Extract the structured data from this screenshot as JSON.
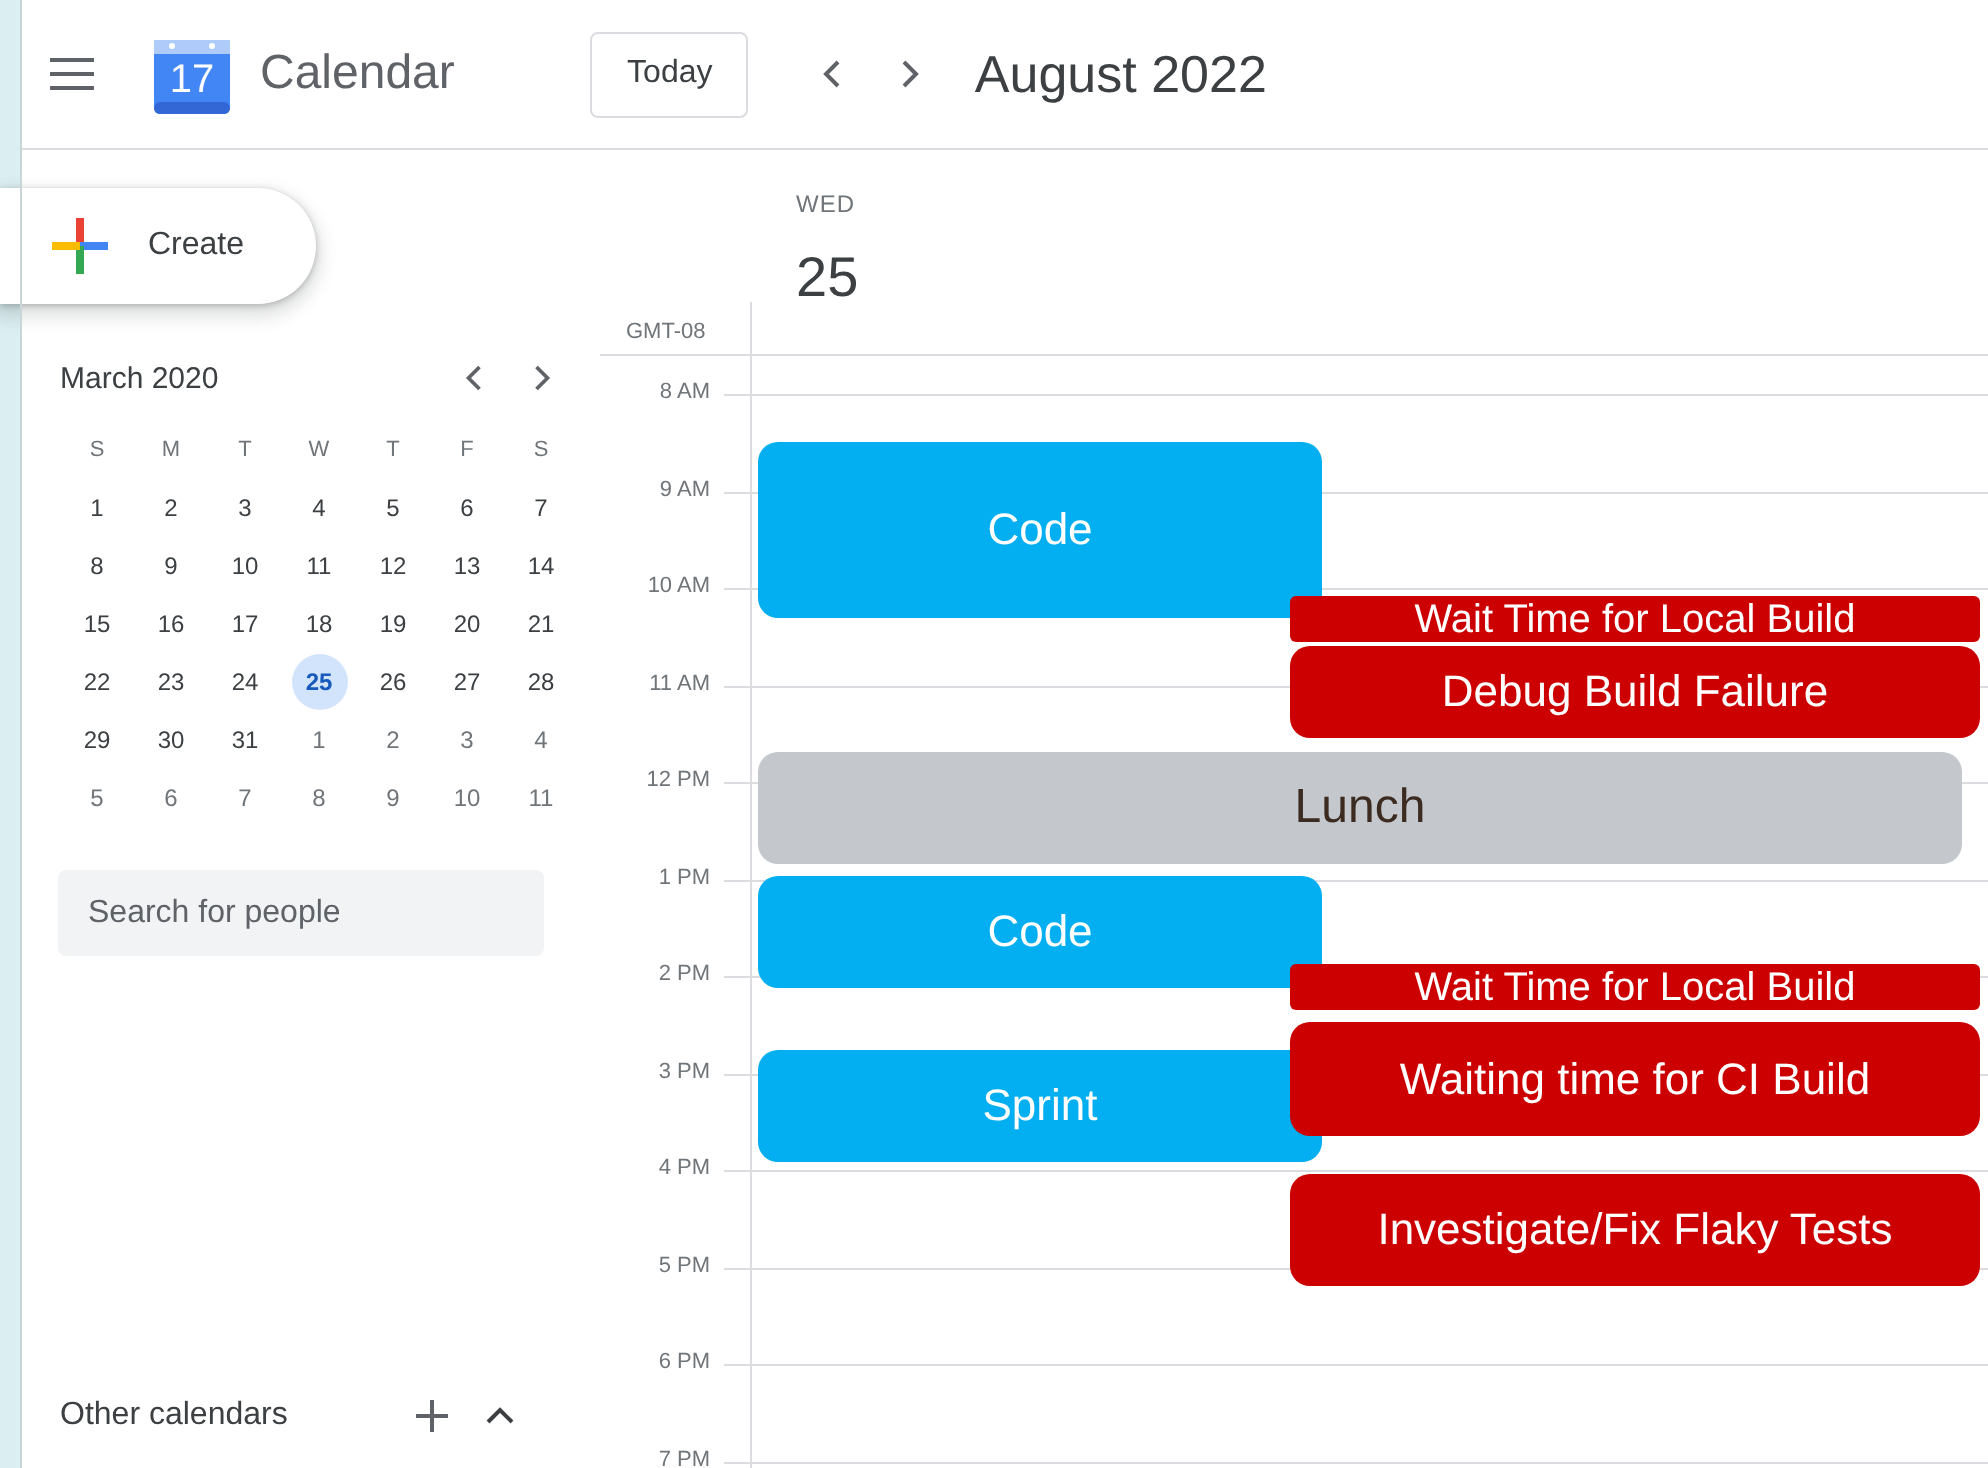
{
  "header": {
    "app_name": "Calendar",
    "logo_day": "17",
    "today_button": "Today",
    "period": "August 2022"
  },
  "sidebar": {
    "create_button": "Create",
    "mini_calendar": {
      "month": "March 2020",
      "weekdays": [
        "S",
        "M",
        "T",
        "W",
        "T",
        "F",
        "S"
      ],
      "days": [
        {
          "label": "1",
          "selected": false,
          "dimmed": false
        },
        {
          "label": "2",
          "selected": false,
          "dimmed": false
        },
        {
          "label": "3",
          "selected": false,
          "dimmed": false
        },
        {
          "label": "4",
          "selected": false,
          "dimmed": false
        },
        {
          "label": "5",
          "selected": false,
          "dimmed": false
        },
        {
          "label": "6",
          "selected": false,
          "dimmed": false
        },
        {
          "label": "7",
          "selected": false,
          "dimmed": false
        },
        {
          "label": "8",
          "selected": false,
          "dimmed": false
        },
        {
          "label": "9",
          "selected": false,
          "dimmed": false
        },
        {
          "label": "10",
          "selected": false,
          "dimmed": false
        },
        {
          "label": "11",
          "selected": false,
          "dimmed": false
        },
        {
          "label": "12",
          "selected": false,
          "dimmed": false
        },
        {
          "label": "13",
          "selected": false,
          "dimmed": false
        },
        {
          "label": "14",
          "selected": false,
          "dimmed": false
        },
        {
          "label": "15",
          "selected": false,
          "dimmed": false
        },
        {
          "label": "16",
          "selected": false,
          "dimmed": false
        },
        {
          "label": "17",
          "selected": false,
          "dimmed": false
        },
        {
          "label": "18",
          "selected": false,
          "dimmed": false
        },
        {
          "label": "19",
          "selected": false,
          "dimmed": false
        },
        {
          "label": "20",
          "selected": false,
          "dimmed": false
        },
        {
          "label": "21",
          "selected": false,
          "dimmed": false
        },
        {
          "label": "22",
          "selected": false,
          "dimmed": false
        },
        {
          "label": "23",
          "selected": false,
          "dimmed": false
        },
        {
          "label": "24",
          "selected": false,
          "dimmed": false
        },
        {
          "label": "25",
          "selected": true,
          "dimmed": false
        },
        {
          "label": "26",
          "selected": false,
          "dimmed": false
        },
        {
          "label": "27",
          "selected": false,
          "dimmed": false
        },
        {
          "label": "28",
          "selected": false,
          "dimmed": false
        },
        {
          "label": "29",
          "selected": false,
          "dimmed": false
        },
        {
          "label": "30",
          "selected": false,
          "dimmed": false
        },
        {
          "label": "31",
          "selected": false,
          "dimmed": false
        },
        {
          "label": "1",
          "selected": false,
          "dimmed": true
        },
        {
          "label": "2",
          "selected": false,
          "dimmed": true
        },
        {
          "label": "3",
          "selected": false,
          "dimmed": true
        },
        {
          "label": "4",
          "selected": false,
          "dimmed": true
        },
        {
          "label": "5",
          "selected": false,
          "dimmed": true
        },
        {
          "label": "6",
          "selected": false,
          "dimmed": true
        },
        {
          "label": "7",
          "selected": false,
          "dimmed": true
        },
        {
          "label": "8",
          "selected": false,
          "dimmed": true
        },
        {
          "label": "9",
          "selected": false,
          "dimmed": true
        },
        {
          "label": "10",
          "selected": false,
          "dimmed": true
        },
        {
          "label": "11",
          "selected": false,
          "dimmed": true
        }
      ]
    },
    "search": {
      "placeholder": "Search for people"
    },
    "other_calendars": "Other calendars"
  },
  "day_view": {
    "weekday": "WED",
    "date": "25",
    "timezone": "GMT-08",
    "hours": [
      "8 AM",
      "9 AM",
      "10 AM",
      "11 AM",
      "12 PM",
      "1 PM",
      "2 PM",
      "3 PM",
      "4 PM",
      "5 PM",
      "6 PM",
      "7 PM"
    ],
    "events": [
      {
        "title": "Code",
        "color": "#03aff0"
      },
      {
        "title": "Wait Time for Local Build",
        "color": "#cc0000"
      },
      {
        "title": "Debug Build Failure",
        "color": "#cc0000"
      },
      {
        "title": "Lunch",
        "color": "#c4c7cc"
      },
      {
        "title": "Code",
        "color": "#03aff0"
      },
      {
        "title": "Wait Time for Local Build",
        "color": "#cc0000"
      },
      {
        "title": "Sprint",
        "color": "#03aff0"
      },
      {
        "title": "Waiting time for CI Build",
        "color": "#cc0000"
      },
      {
        "title": "Investigate/Fix Flaky Tests",
        "color": "#cc0000"
      }
    ]
  }
}
